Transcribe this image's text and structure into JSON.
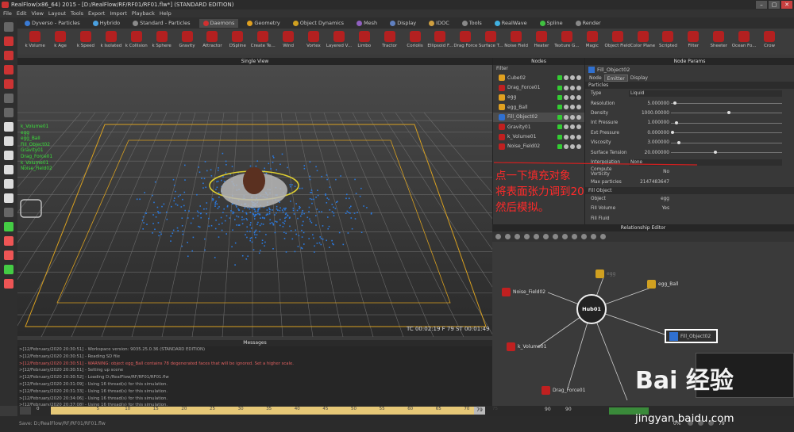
{
  "app": {
    "title": "RealFlow(x86_64) 2015 - [D:/RealFlow/RF/RF01/RF01.flw*] (STANDARD EDITION)",
    "win_buttons": [
      "–",
      "▢",
      "✕"
    ]
  },
  "menu": [
    "File",
    "Edit",
    "View",
    "Layout",
    "Tools",
    "Export",
    "Import",
    "Playback",
    "Help"
  ],
  "tabs": [
    {
      "label": "Dyverso - Particles",
      "color": "#3a7bd5"
    },
    {
      "label": "Hybrido",
      "color": "#4aa0e0"
    },
    {
      "label": "Standard - Particles",
      "color": "#8a8a8a"
    },
    {
      "label": "Daemons",
      "color": "#d03030",
      "active": true
    },
    {
      "label": "Geometry",
      "color": "#e0a020"
    },
    {
      "label": "Object Dynamics",
      "color": "#d0a020"
    },
    {
      "label": "Mesh",
      "color": "#9060c0"
    },
    {
      "label": "Display",
      "color": "#6080c0"
    },
    {
      "label": "IDOC",
      "color": "#d0a040"
    },
    {
      "label": "Tools",
      "color": "#888"
    },
    {
      "label": "RealWave",
      "color": "#40b0e0"
    },
    {
      "label": "Spline",
      "color": "#40c040"
    },
    {
      "label": "Render",
      "color": "#888"
    }
  ],
  "shelf": [
    "k Volume",
    "k Age",
    "k Speed",
    "k Isolated",
    "k Collision",
    "k Sphere",
    "Gravity",
    "Attractor",
    "DSpline",
    "Create Te...",
    "Wind",
    "Vortex",
    "Layered V...",
    "Limbo",
    "Tractor",
    "Coriolis",
    "Ellipsoid F...",
    "Drag Force",
    "Surface T...",
    "Noise Field",
    "Heater",
    "Texture G...",
    "Magic",
    "Object Field",
    "Color Plane",
    "Scripted",
    "Filter",
    "Sheeter",
    "Ocean Fo...",
    "Crow"
  ],
  "viewport": {
    "title": "Single View",
    "overlay_nodes": [
      "k_Volume01",
      "egg",
      "egg_Ball",
      "Fill_Object02",
      "Gravity01",
      "Drag_Force01",
      "k_Volume01",
      "Noise_Field02"
    ],
    "timecode": "TC 00:02:19   F 79   ST 00:01:49"
  },
  "annotation": [
    "点一下填充对象",
    "将表面张力调到20",
    "然后模拟。"
  ],
  "nodes": {
    "title": "Nodes",
    "filter": "Filter",
    "items": [
      {
        "name": "Cube02",
        "color": "#e0a020"
      },
      {
        "name": "Drag_Force01",
        "color": "#c02020"
      },
      {
        "name": "egg",
        "color": "#e0a020"
      },
      {
        "name": "egg_Ball",
        "color": "#e0a020"
      },
      {
        "name": "Fill_Object02",
        "color": "#3070d0",
        "selected": true
      },
      {
        "name": "Gravity01",
        "color": "#c02020"
      },
      {
        "name": "k_Volume01",
        "color": "#c02020"
      },
      {
        "name": "Noise_Field02",
        "color": "#c02020"
      }
    ]
  },
  "params": {
    "title": "Node Params",
    "object": "Fill_Object02",
    "tabs": [
      "Node",
      "Emitter",
      "Display"
    ],
    "active_tab": "Emitter",
    "section": "Particles",
    "rows": [
      {
        "label": "Type",
        "value": "Liquid",
        "select": true
      },
      {
        "label": "Resolution",
        "value": "5.000000",
        "level": 0.02
      },
      {
        "label": "Density",
        "value": "1000.00000",
        "level": 0.52
      },
      {
        "label": "Int Pressure",
        "value": "1.000000",
        "level": 0.04
      },
      {
        "label": "Ext Pressure",
        "value": "0.000000",
        "level": 0.0
      },
      {
        "label": "Viscosity",
        "value": "3.000000",
        "level": 0.06
      },
      {
        "label": "Surface Tension",
        "value": "20.000000",
        "level": 0.4
      },
      {
        "label": "Interpolation",
        "value": "None",
        "select": true
      },
      {
        "label": "Compute Vorticity",
        "value": "No"
      },
      {
        "label": "Max particles",
        "value": "2147483647"
      }
    ],
    "section2": "Fill Object",
    "rows2": [
      {
        "label": "Object",
        "value": "egg"
      },
      {
        "label": "Fill Volume",
        "value": "Yes"
      },
      {
        "label": "Fill Fluid",
        "value": ""
      }
    ]
  },
  "relationship": {
    "title": "Relationship Editor",
    "hub": "Hub01",
    "nodes": [
      {
        "name": "egg",
        "color": "#d0a020"
      },
      {
        "name": "egg_Ball",
        "color": "#d0a020"
      },
      {
        "name": "Noise_Field02",
        "color": "#c02020"
      },
      {
        "name": "Fill_Object02",
        "color": "#3070d0"
      },
      {
        "name": "k_Volume01",
        "color": "#c02020"
      },
      {
        "name": "Drag_Force01",
        "color": "#c02020"
      }
    ]
  },
  "messages": {
    "title": "Messages",
    "lines": [
      {
        "t": ">[12/February/2020 20:30:51] - Workspace version: 9035.25.0.36 (STANDARD EDITION)"
      },
      {
        "t": ">[12/February/2020 20:30:51] - Reading SD file"
      },
      {
        "t": ">[12/February/2020 20:30:51] - WARNING: object egg_Ball contains 78 degenerated faces that will be ignored. Set a higher scale.",
        "err": true
      },
      {
        "t": ">[12/February/2020 20:30:51] - Setting up scene"
      },
      {
        "t": ">[12/February/2020 20:30:52] - Loading D:/RealFlow/RF/RF01/RF01.flw"
      },
      {
        "t": ">[12/February/2020 20:31:09] - Using 16 thread(s) for this simulation."
      },
      {
        "t": ">[12/February/2020 20:31:33] - Using 16 thread(s) for this simulation."
      },
      {
        "t": ">[12/February/2020 20:34:06] - Using 16 thread(s) for this simulation."
      },
      {
        "t": ">[12/February/2020 20:37:08] - Using 16 thread(s) for this simulation."
      },
      {
        "t": ">[12/February/2020 20:39:28] - Save: D:/RealFlow/RF/RF01/RF01.flw"
      }
    ]
  },
  "timeline": {
    "start": "0",
    "ticks": [
      "5",
      "10",
      "15",
      "20",
      "25",
      "30",
      "35",
      "40",
      "45",
      "50",
      "55",
      "60",
      "65",
      "70",
      "75"
    ],
    "current": "79",
    "end1": "90",
    "end2": "90"
  },
  "status": {
    "save_msg": "Save: D:/RealFlow/RF/RF01/RF01.flw",
    "zoom": "0%",
    "frame": "79"
  },
  "watermark": {
    "site": "jingyan.baidu.com",
    "brand": "Bai 经验"
  }
}
